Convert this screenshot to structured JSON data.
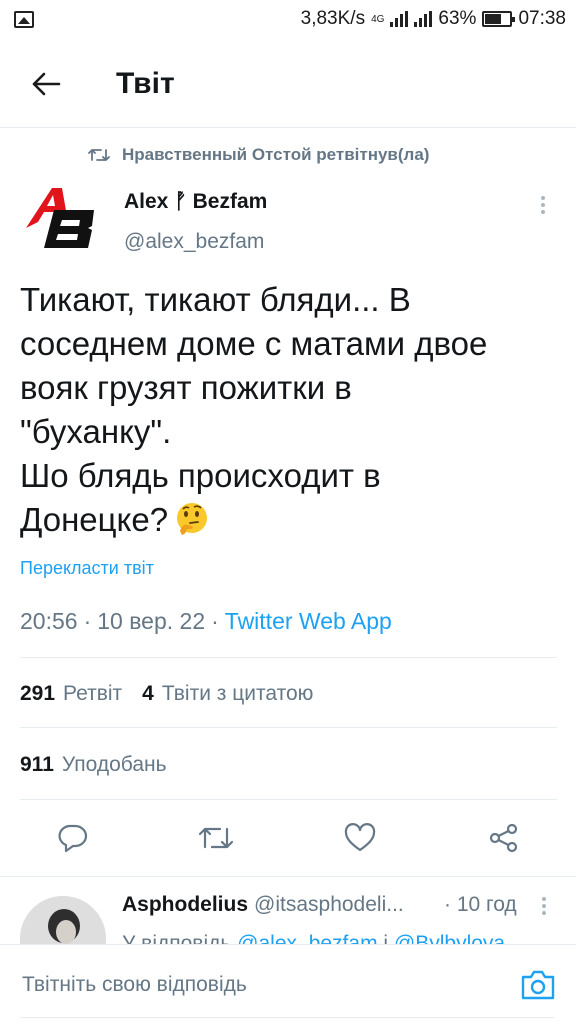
{
  "status_bar": {
    "speed": "3,83K/s",
    "network": "4G",
    "battery": "63%",
    "time": "07:38"
  },
  "header": {
    "title": "Твіт"
  },
  "tweet": {
    "retweeted_by": "Нравственный Отстой ретвітнув(ла)",
    "author_name": "Alex ᚡ Bezfam",
    "author_handle": "@alex_bezfam",
    "text": "Тикают, тикают бляди... В\nсоседнем доме с матами двое\nвояк грузят пожитки в\n\"буханку\".\nШо блядь происходит в\nДонецке?",
    "emoji": "thinking-face",
    "translate_label": "Перекласти твіт",
    "time": "20:56",
    "date": "10 вер. 22",
    "source": "Twitter Web App",
    "dot": "·",
    "retweets_count": "291",
    "retweets_label": "Ретвіт",
    "quotes_count": "4",
    "quotes_label": "Твіти з цитатою",
    "likes_count": "911",
    "likes_label": "Уподобань"
  },
  "reply": {
    "name": "Asphodelius",
    "handle": "@itsasphodeli...",
    "time": "· 10 год",
    "reply_prefix": "У відповідь",
    "mention1": "@alex_bezfam",
    "conj": "і",
    "mention2": "@Bylbylova"
  },
  "compose": {
    "placeholder": "Твітніть свою відповідь"
  },
  "colors": {
    "accent": "#1da1f2",
    "muted": "#657786",
    "text": "#14171a",
    "logo_red": "#e0141a"
  }
}
